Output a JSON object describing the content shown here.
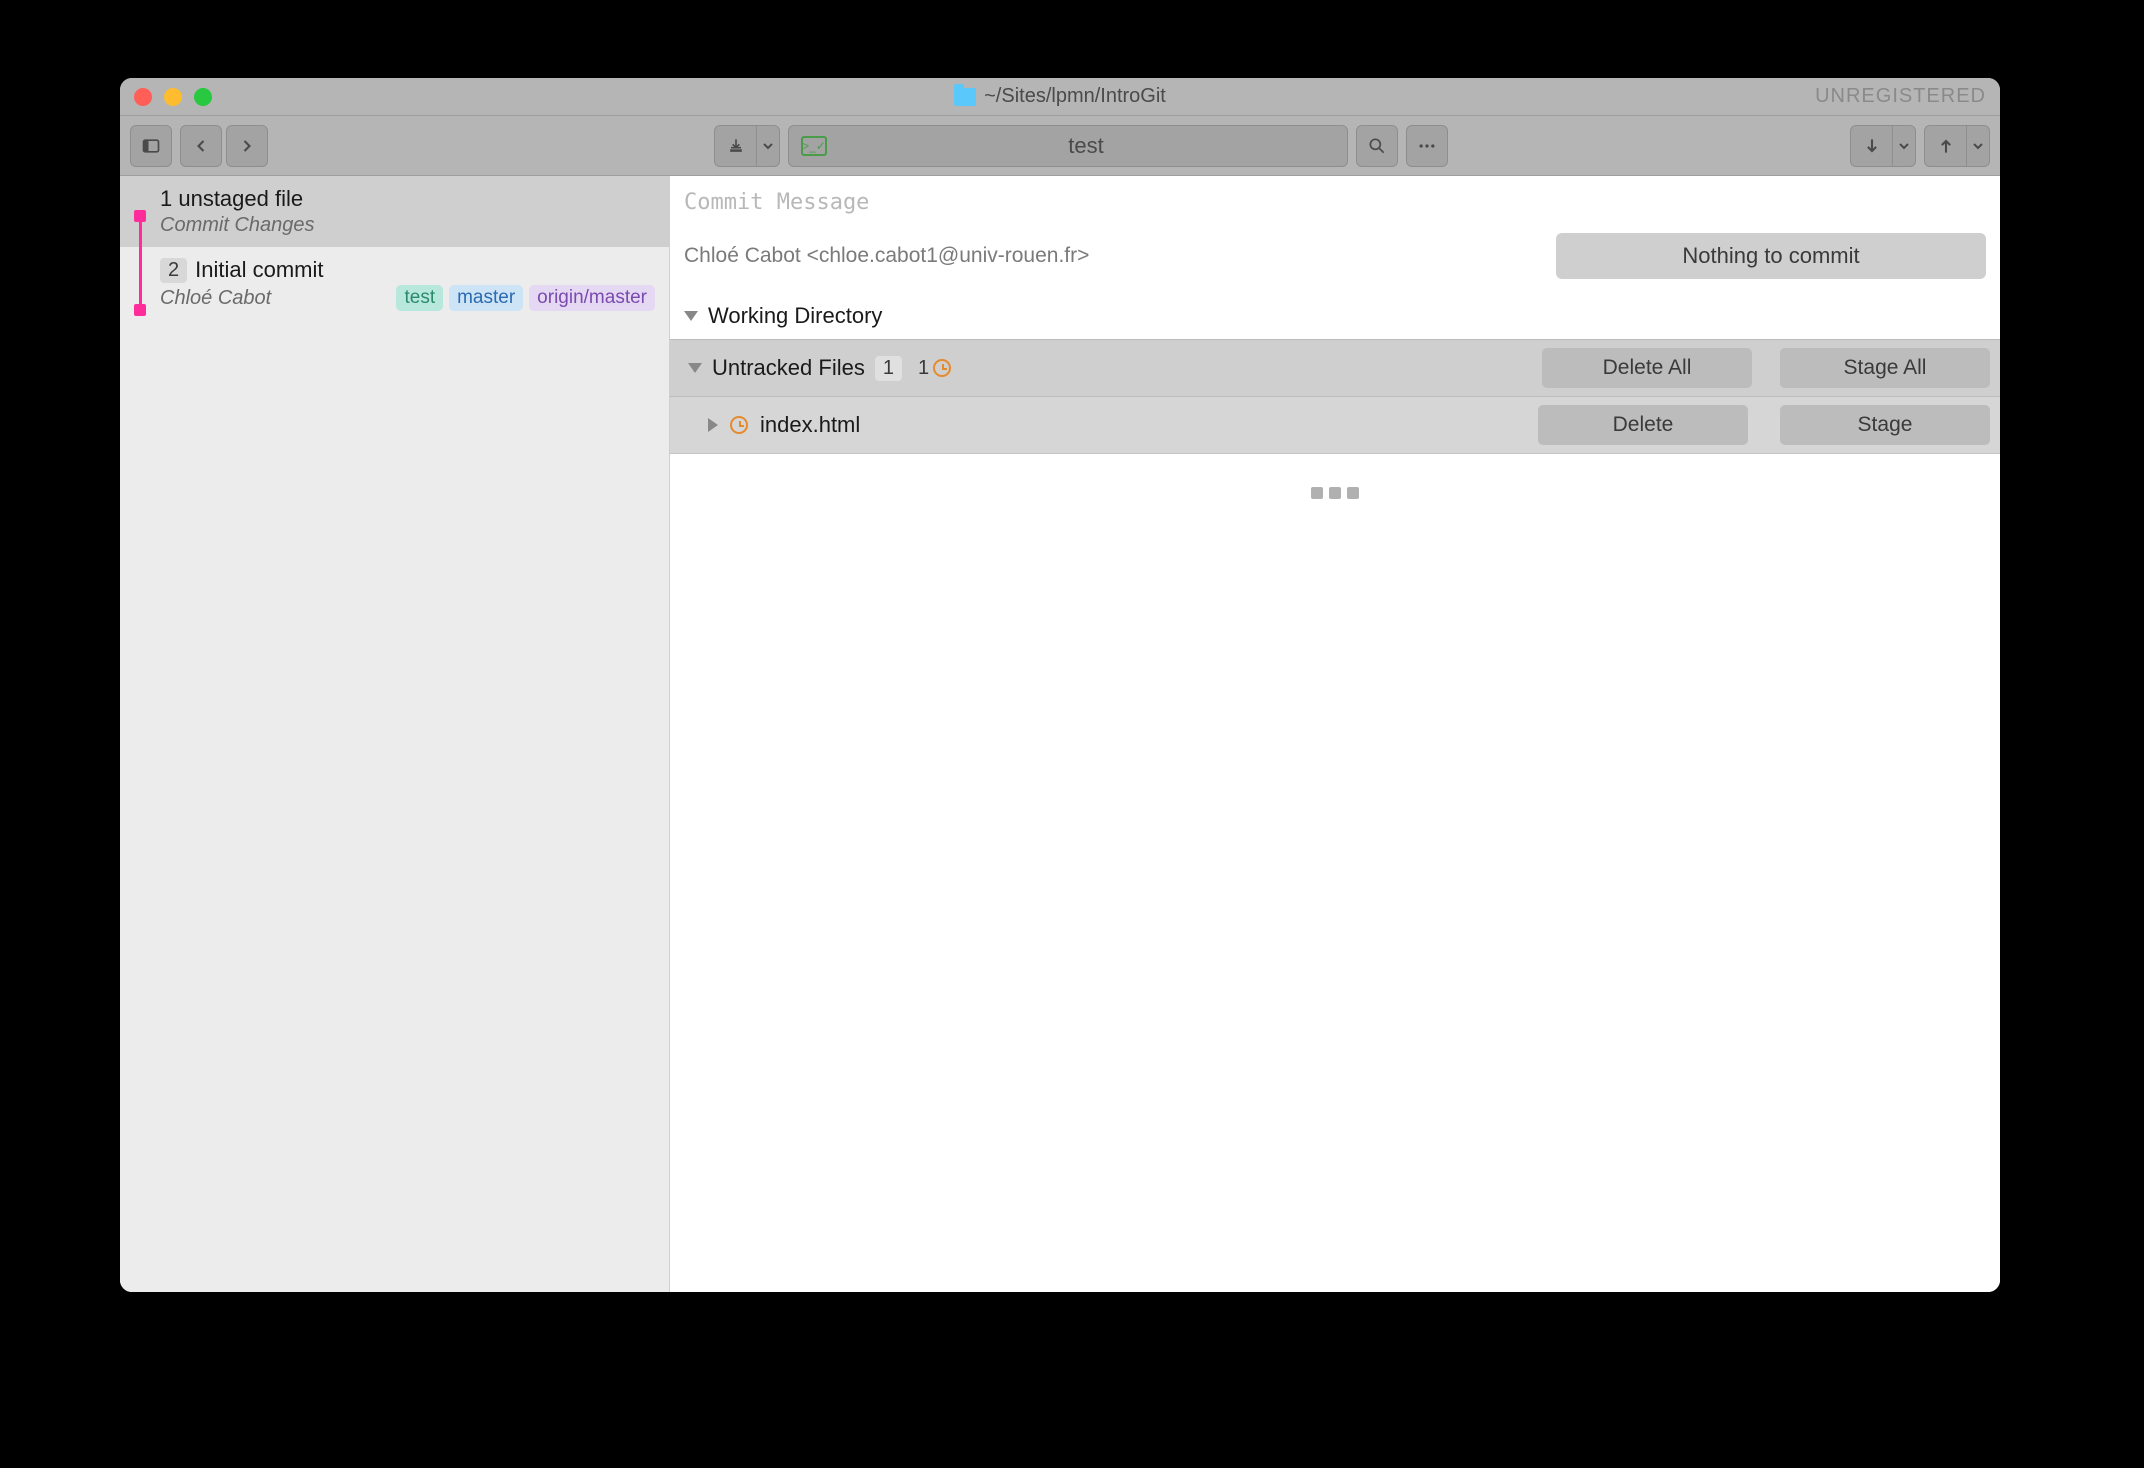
{
  "window": {
    "title_path": "~/Sites/lpmn/IntroGit",
    "registration": "UNREGISTERED"
  },
  "toolbar": {
    "branch_name": "test"
  },
  "sidebar": {
    "uncommitted": {
      "title": "1 unstaged file",
      "subtitle": "Commit Changes"
    },
    "commits": [
      {
        "count": "2",
        "title": "Initial commit",
        "author": "Chloé Cabot",
        "tags": [
          {
            "label": "test",
            "class": "tag-test"
          },
          {
            "label": "master",
            "class": "tag-master"
          },
          {
            "label": "origin/master",
            "class": "tag-origin"
          }
        ]
      }
    ]
  },
  "main": {
    "commit_placeholder": "Commit Message",
    "author_identity": "Chloé Cabot <chloe.cabot1@univ-rouen.fr>",
    "commit_button": "Nothing to commit",
    "working_directory_label": "Working Directory",
    "untracked": {
      "label": "Untracked Files",
      "count": "1",
      "pending": "1",
      "delete_all": "Delete All",
      "stage_all": "Stage All"
    },
    "files": [
      {
        "name": "index.html",
        "delete": "Delete",
        "stage": "Stage"
      }
    ]
  }
}
